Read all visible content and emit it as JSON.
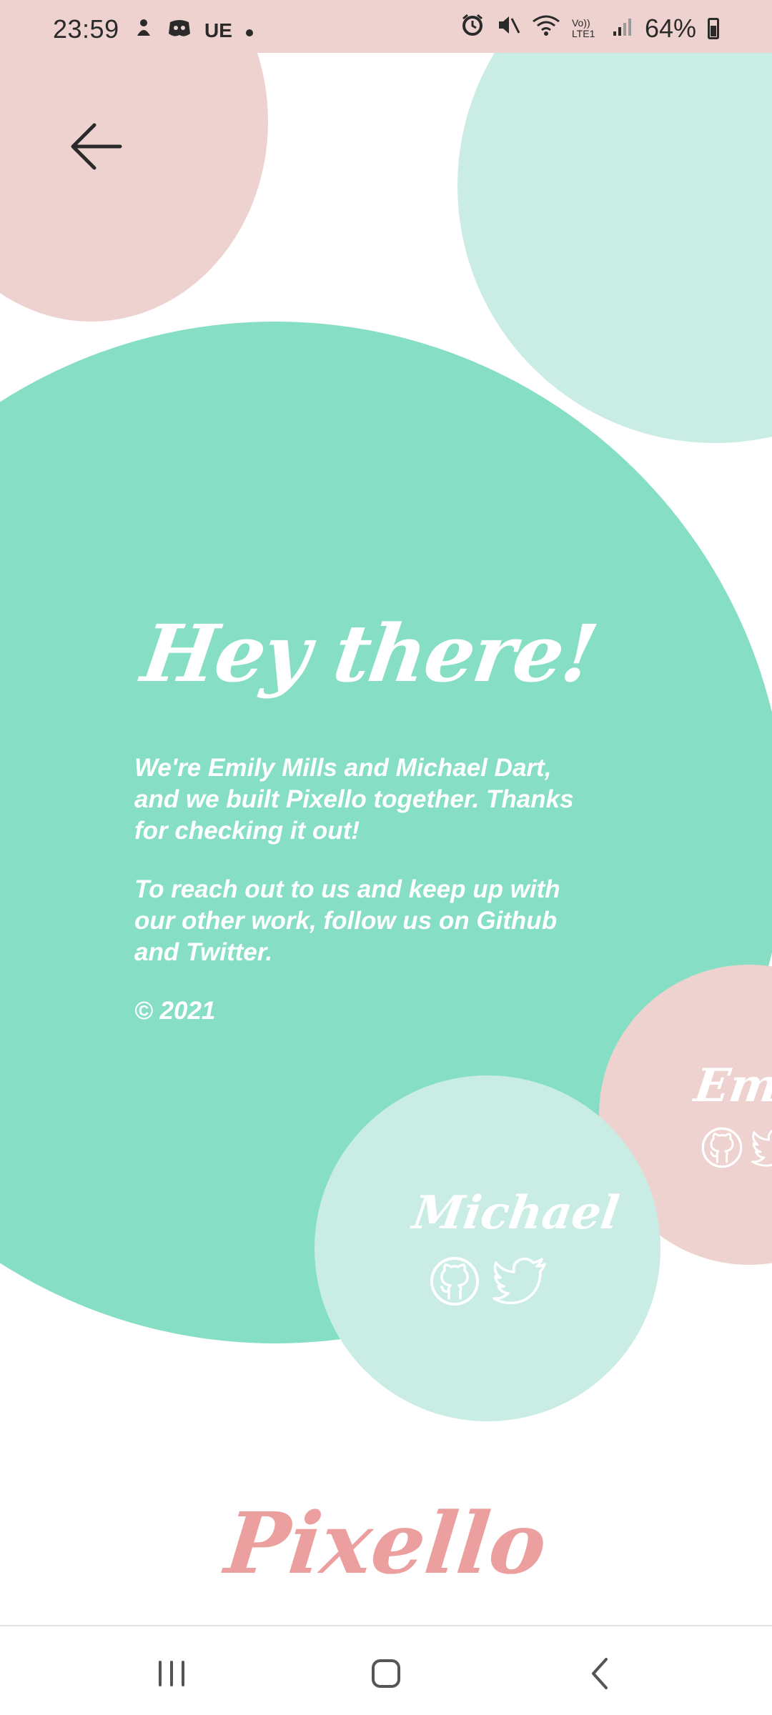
{
  "status_bar": {
    "time": "23:59",
    "carrier_text": "UE",
    "battery_percent": "64%",
    "volte_label": "Vo)) LTE1"
  },
  "header": {
    "back_icon": "arrow-left-icon"
  },
  "about": {
    "heading": "Hey there!",
    "paragraph_1": "We're Emily Mills and Michael Dart, and we built Pixello together. Thanks for checking it out!",
    "paragraph_2": "To reach out to us and keep up with our other work, follow us on Github and Twitter.",
    "copyright": "© 2021"
  },
  "people": [
    {
      "name": "Michael",
      "icons": [
        "github-icon",
        "twitter-icon"
      ]
    },
    {
      "name": "Emil",
      "icons": [
        "github-icon",
        "twitter-icon"
      ]
    }
  ],
  "footer": {
    "logo_text": "Pixello"
  },
  "colors": {
    "mint": "#86dec4",
    "light_mint": "#c9ede5",
    "pink": "#eed2cf",
    "logo_pink": "#eba09f"
  }
}
